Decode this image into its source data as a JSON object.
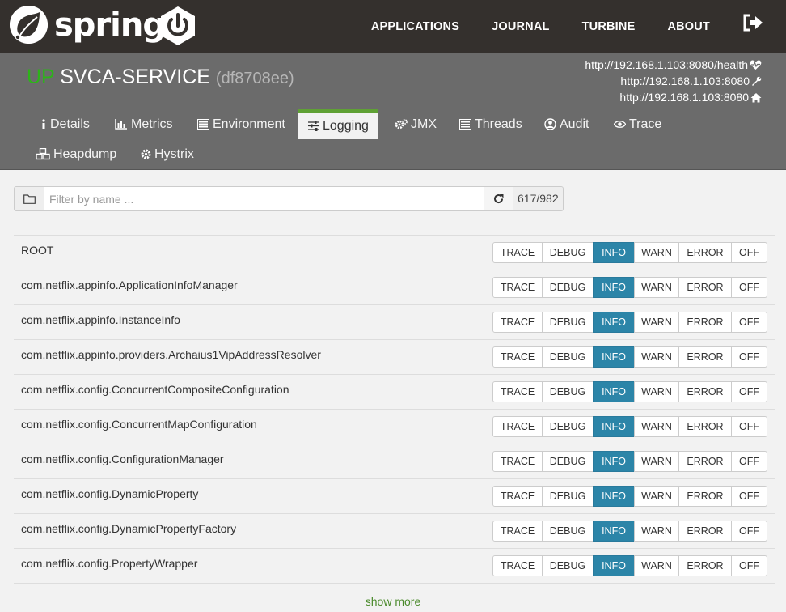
{
  "brand": {
    "name": "spring"
  },
  "nav": {
    "items": [
      "APPLICATIONS",
      "JOURNAL",
      "TURBINE",
      "ABOUT"
    ]
  },
  "app": {
    "status": "UP",
    "name": "SVCA-SERVICE",
    "id": "(df8708ee)",
    "status_color": "#2db31a",
    "urls": [
      {
        "text": "http://192.168.1.103:8080/health",
        "icon": "heartbeat-icon"
      },
      {
        "text": "http://192.168.1.103:8080",
        "icon": "wrench-icon"
      },
      {
        "text": "http://192.168.1.103:8080",
        "icon": "home-icon"
      }
    ]
  },
  "tabs": [
    {
      "label": "Details",
      "icon": "info-icon"
    },
    {
      "label": "Metrics",
      "icon": "bar-chart-icon"
    },
    {
      "label": "Environment",
      "icon": "list-icon"
    },
    {
      "label": "Logging",
      "icon": "sliders-icon",
      "active": true
    },
    {
      "label": "JMX",
      "icon": "cogs-icon"
    },
    {
      "label": "Threads",
      "icon": "list-alt-icon"
    },
    {
      "label": "Audit",
      "icon": "user-circle-icon"
    },
    {
      "label": "Trace",
      "icon": "eye-icon"
    },
    {
      "label": "Heapdump",
      "icon": "cubes-icon"
    },
    {
      "label": "Hystrix",
      "icon": "gear-icon"
    }
  ],
  "filter": {
    "placeholder": "Filter by name ...",
    "count": "617/982"
  },
  "levels": [
    "TRACE",
    "DEBUG",
    "INFO",
    "WARN",
    "ERROR",
    "OFF"
  ],
  "accent_color": "#2c85a8",
  "loggers": [
    {
      "name": "ROOT",
      "level": "INFO"
    },
    {
      "name": "com.netflix.appinfo.ApplicationInfoManager",
      "level": "INFO"
    },
    {
      "name": "com.netflix.appinfo.InstanceInfo",
      "level": "INFO"
    },
    {
      "name": "com.netflix.appinfo.providers.Archaius1VipAddressResolver",
      "level": "INFO"
    },
    {
      "name": "com.netflix.config.ConcurrentCompositeConfiguration",
      "level": "INFO"
    },
    {
      "name": "com.netflix.config.ConcurrentMapConfiguration",
      "level": "INFO"
    },
    {
      "name": "com.netflix.config.ConfigurationManager",
      "level": "INFO"
    },
    {
      "name": "com.netflix.config.DynamicProperty",
      "level": "INFO"
    },
    {
      "name": "com.netflix.config.DynamicPropertyFactory",
      "level": "INFO"
    },
    {
      "name": "com.netflix.config.PropertyWrapper",
      "level": "INFO"
    }
  ],
  "show_more": "show more"
}
